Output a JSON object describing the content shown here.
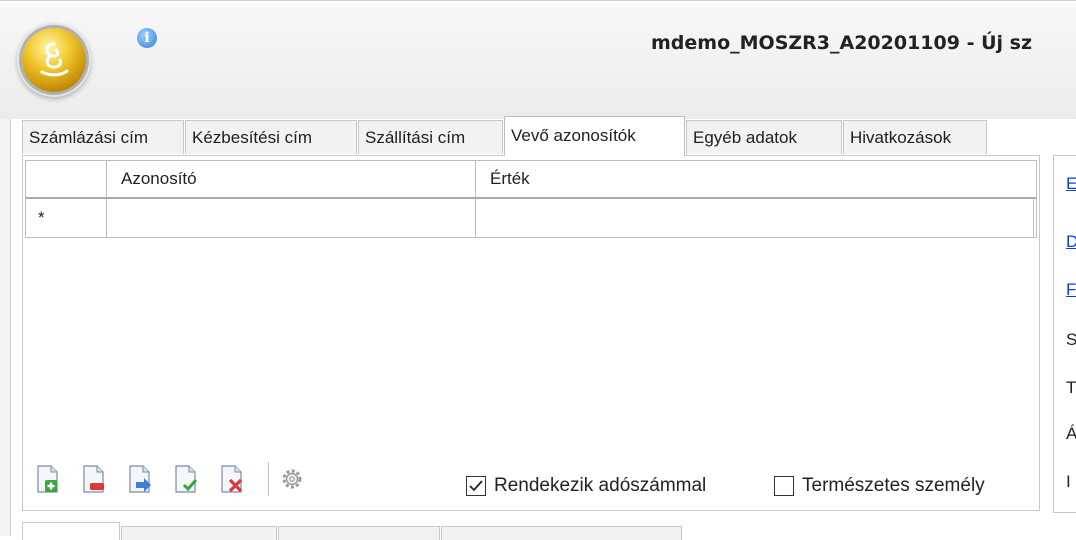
{
  "window": {
    "title": "mdemo_MOSZR3_A20201109 - Új sz"
  },
  "tabs": [
    {
      "label": "Számlázási cím"
    },
    {
      "label": "Kézbesítési cím"
    },
    {
      "label": "Szállítási cím"
    },
    {
      "label": "Vevő azonosítók",
      "active": true
    },
    {
      "label": "Egyéb adatok"
    },
    {
      "label": "Hivatkozások"
    }
  ],
  "grid": {
    "columns": [
      "",
      "Azonosító",
      "Érték"
    ],
    "new_row_marker": "*",
    "rows": [
      {
        "azonosito": "",
        "ertek": ""
      }
    ]
  },
  "toolbar": {
    "buttons": [
      "add-row-icon",
      "delete-row-icon",
      "move-row-icon",
      "edit-row-icon",
      "cancel-row-icon",
      "settings-gear-icon"
    ]
  },
  "checkboxes": {
    "vat_number": {
      "label": "Rendekezik adószámmal",
      "checked": true
    },
    "natural_person": {
      "label": "Természetes személy",
      "checked": false
    }
  },
  "right_panel": {
    "labels": [
      "E",
      "D",
      "F",
      "S",
      "T",
      "Á",
      "I"
    ]
  },
  "colors": {
    "link": "#0a3fd4",
    "app_orb": "#f2c930",
    "info_icon": "#2f7fd8"
  }
}
